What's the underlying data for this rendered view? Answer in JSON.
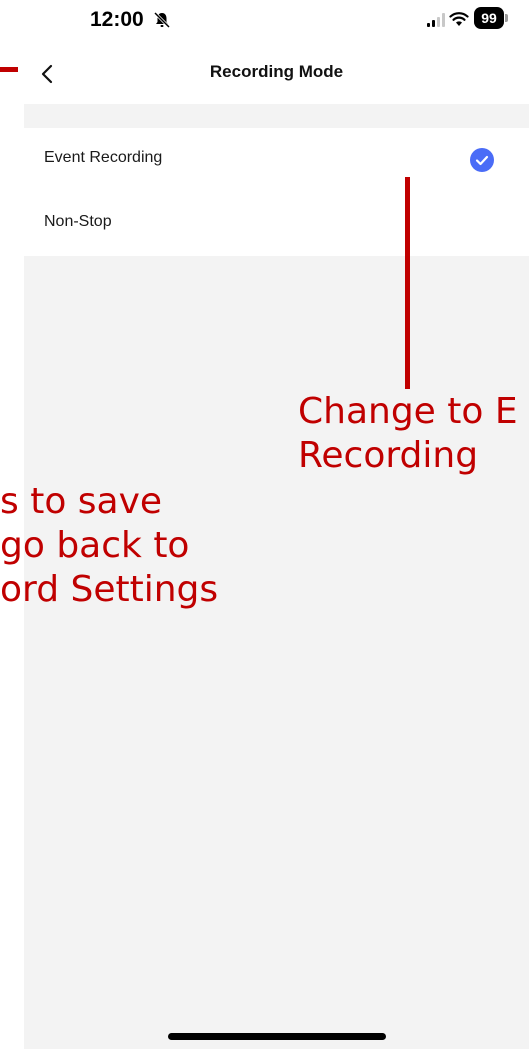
{
  "status_bar": {
    "time": "12:00",
    "battery": "99",
    "icons": [
      "bell-slash-icon",
      "signal-icon",
      "wifi-icon",
      "battery-icon"
    ]
  },
  "nav": {
    "title": "Recording Mode",
    "back_icon": "chevron-left-icon"
  },
  "options": [
    {
      "label": "Event Recording",
      "selected": true
    },
    {
      "label": "Non-Stop",
      "selected": false
    }
  ],
  "colors": {
    "accent": "#4a6cf7",
    "annotation": "#c00000",
    "background": "#f3f3f3"
  },
  "annotations": {
    "right_line1": "Change to E",
    "right_line2": "Recording",
    "left_line1": "s to save",
    "left_line2": "go back to",
    "left_line3": "ord Settings"
  }
}
